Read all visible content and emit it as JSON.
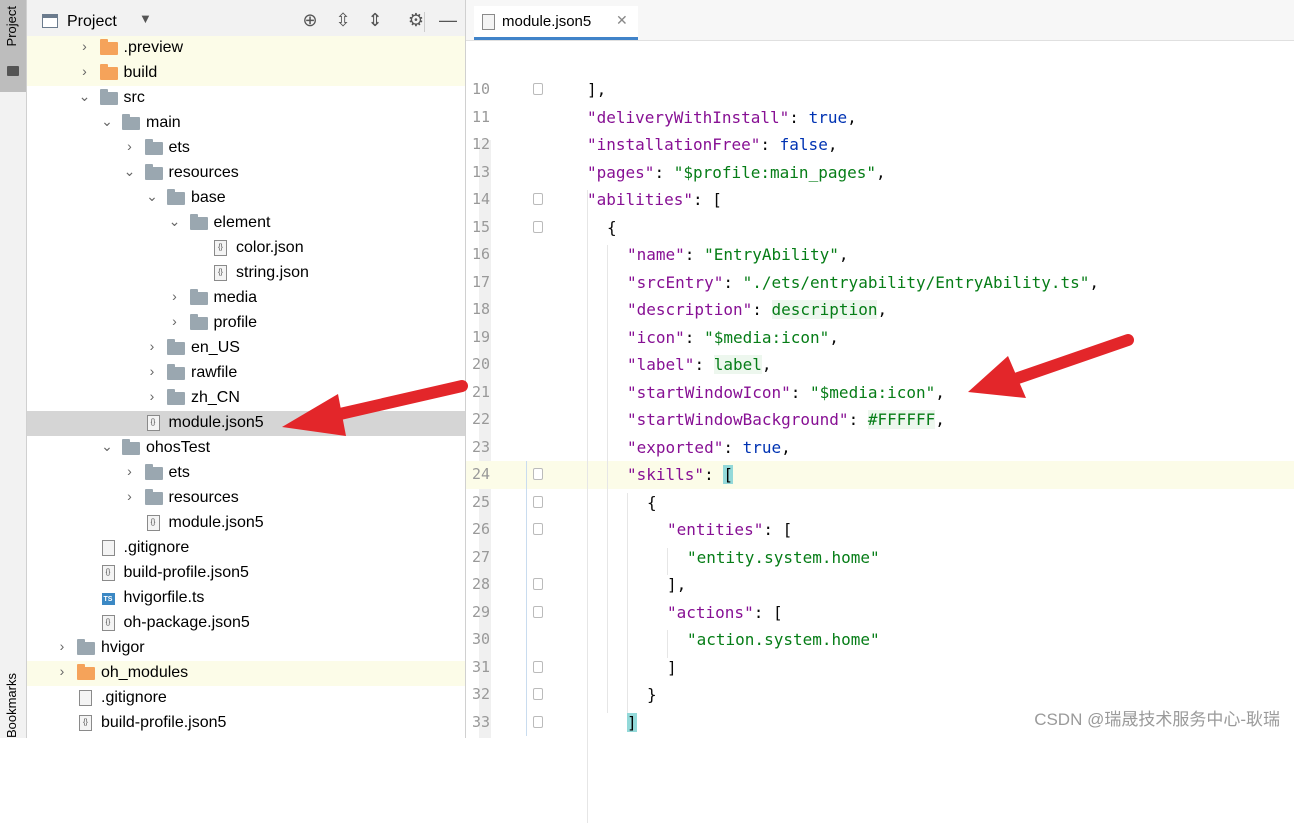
{
  "sidebar_strip": {
    "project_tab": "Project",
    "bookmarks_tab": "Bookmarks"
  },
  "project_panel": {
    "title": "Project",
    "tree": [
      {
        "label": ".preview",
        "type": "folder-orange",
        "indent": 1,
        "expanded": false,
        "highlight": true
      },
      {
        "label": "build",
        "type": "folder-orange",
        "indent": 1,
        "expanded": false,
        "highlight": true
      },
      {
        "label": "src",
        "type": "folder",
        "indent": 1,
        "expanded": true
      },
      {
        "label": "main",
        "type": "folder",
        "indent": 2,
        "expanded": true
      },
      {
        "label": "ets",
        "type": "folder",
        "indent": 3,
        "expanded": false
      },
      {
        "label": "resources",
        "type": "folder",
        "indent": 3,
        "expanded": true
      },
      {
        "label": "base",
        "type": "folder",
        "indent": 4,
        "expanded": true
      },
      {
        "label": "element",
        "type": "folder",
        "indent": 5,
        "expanded": true
      },
      {
        "label": "color.json",
        "type": "json",
        "indent": 6
      },
      {
        "label": "string.json",
        "type": "json",
        "indent": 6
      },
      {
        "label": "media",
        "type": "folder",
        "indent": 5,
        "expanded": false
      },
      {
        "label": "profile",
        "type": "folder",
        "indent": 5,
        "expanded": false
      },
      {
        "label": "en_US",
        "type": "folder",
        "indent": 4,
        "expanded": false
      },
      {
        "label": "rawfile",
        "type": "folder",
        "indent": 4,
        "expanded": false
      },
      {
        "label": "zh_CN",
        "type": "folder",
        "indent": 4,
        "expanded": false
      },
      {
        "label": "module.json5",
        "type": "json",
        "indent": 3,
        "selected": true
      },
      {
        "label": "ohosTest",
        "type": "folder",
        "indent": 2,
        "expanded": true
      },
      {
        "label": "ets",
        "type": "folder",
        "indent": 3,
        "expanded": false
      },
      {
        "label": "resources",
        "type": "folder",
        "indent": 3,
        "expanded": false
      },
      {
        "label": "module.json5",
        "type": "json",
        "indent": 3
      },
      {
        "label": ".gitignore",
        "type": "file",
        "indent": 1
      },
      {
        "label": "build-profile.json5",
        "type": "json",
        "indent": 1
      },
      {
        "label": "hvigorfile.ts",
        "type": "ts",
        "indent": 1
      },
      {
        "label": "oh-package.json5",
        "type": "json",
        "indent": 1
      },
      {
        "label": "hvigor",
        "type": "folder",
        "indent": 0,
        "expanded": false
      },
      {
        "label": "oh_modules",
        "type": "folder-orange",
        "indent": 0,
        "expanded": false,
        "highlight": true
      },
      {
        "label": ".gitignore",
        "type": "file",
        "indent": 0
      },
      {
        "label": "build-profile.json5",
        "type": "json",
        "indent": 0
      }
    ]
  },
  "editor": {
    "tab_label": "module.json5",
    "current_line": 24,
    "lines": [
      {
        "n": "10",
        "indent": 0,
        "parts": [
          [
            "p",
            "],"
          ]
        ]
      },
      {
        "n": "11",
        "indent": 0,
        "parts": [
          [
            "k",
            "\"deliveryWithInstall\""
          ],
          [
            "p",
            ": "
          ],
          [
            "b",
            "true"
          ],
          [
            "p",
            ","
          ]
        ]
      },
      {
        "n": "12",
        "indent": 0,
        "parts": [
          [
            "k",
            "\"installationFree\""
          ],
          [
            "p",
            ": "
          ],
          [
            "b",
            "false"
          ],
          [
            "p",
            ","
          ]
        ]
      },
      {
        "n": "13",
        "indent": 0,
        "parts": [
          [
            "k",
            "\"pages\""
          ],
          [
            "p",
            ": "
          ],
          [
            "s",
            "\"$profile:main_pages\""
          ],
          [
            "p",
            ","
          ]
        ]
      },
      {
        "n": "14",
        "indent": 0,
        "parts": [
          [
            "k",
            "\"abilities\""
          ],
          [
            "p",
            ": ["
          ]
        ]
      },
      {
        "n": "15",
        "indent": 1,
        "parts": [
          [
            "p",
            "{"
          ]
        ]
      },
      {
        "n": "16",
        "indent": 2,
        "parts": [
          [
            "k",
            "\"name\""
          ],
          [
            "p",
            ": "
          ],
          [
            "s",
            "\"EntryAbility\""
          ],
          [
            "p",
            ","
          ]
        ]
      },
      {
        "n": "17",
        "indent": 2,
        "parts": [
          [
            "k",
            "\"srcEntry\""
          ],
          [
            "p",
            ": "
          ],
          [
            "s",
            "\"./ets/entryability/EntryAbility.ts\""
          ],
          [
            "p",
            ","
          ]
        ]
      },
      {
        "n": "18",
        "indent": 2,
        "parts": [
          [
            "k",
            "\"description\""
          ],
          [
            "p",
            ": "
          ],
          [
            "ref",
            "description"
          ],
          [
            "p",
            ","
          ]
        ]
      },
      {
        "n": "19",
        "indent": 2,
        "parts": [
          [
            "k",
            "\"icon\""
          ],
          [
            "p",
            ": "
          ],
          [
            "s",
            "\"$media:icon\""
          ],
          [
            "p",
            ","
          ]
        ]
      },
      {
        "n": "20",
        "indent": 2,
        "parts": [
          [
            "k",
            "\"label\""
          ],
          [
            "p",
            ": "
          ],
          [
            "ref",
            "label"
          ],
          [
            "p",
            ","
          ]
        ]
      },
      {
        "n": "21",
        "indent": 2,
        "parts": [
          [
            "k",
            "\"startWindowIcon\""
          ],
          [
            "p",
            ": "
          ],
          [
            "s",
            "\"$media:icon\""
          ],
          [
            "p",
            ","
          ]
        ]
      },
      {
        "n": "22",
        "indent": 2,
        "parts": [
          [
            "k",
            "\"startWindowBackground\""
          ],
          [
            "p",
            ": "
          ],
          [
            "ref",
            "#FFFFFF"
          ],
          [
            "p",
            ","
          ]
        ]
      },
      {
        "n": "23",
        "indent": 2,
        "parts": [
          [
            "k",
            "\"exported\""
          ],
          [
            "p",
            ": "
          ],
          [
            "b",
            "true"
          ],
          [
            "p",
            ","
          ]
        ]
      },
      {
        "n": "24",
        "indent": 2,
        "parts": [
          [
            "k",
            "\"skills\""
          ],
          [
            "p",
            ": "
          ],
          [
            "bm",
            "["
          ]
        ]
      },
      {
        "n": "25",
        "indent": 3,
        "parts": [
          [
            "p",
            "{"
          ]
        ]
      },
      {
        "n": "26",
        "indent": 4,
        "parts": [
          [
            "k",
            "\"entities\""
          ],
          [
            "p",
            ": ["
          ]
        ]
      },
      {
        "n": "27",
        "indent": 5,
        "parts": [
          [
            "s",
            "\"entity.system.home\""
          ]
        ]
      },
      {
        "n": "28",
        "indent": 4,
        "parts": [
          [
            "p",
            "],"
          ]
        ]
      },
      {
        "n": "29",
        "indent": 4,
        "parts": [
          [
            "k",
            "\"actions\""
          ],
          [
            "p",
            ": ["
          ]
        ]
      },
      {
        "n": "30",
        "indent": 5,
        "parts": [
          [
            "s",
            "\"action.system.home\""
          ]
        ]
      },
      {
        "n": "31",
        "indent": 4,
        "parts": [
          [
            "p",
            "]"
          ]
        ]
      },
      {
        "n": "32",
        "indent": 3,
        "parts": [
          [
            "p",
            "}"
          ]
        ]
      },
      {
        "n": "33",
        "indent": 2,
        "parts": [
          [
            "bm",
            "]"
          ]
        ]
      }
    ]
  },
  "watermark": "CSDN @瑞晟技术服务中心-耿瑞",
  "colors": {
    "annotation_arrow": "#e3262a",
    "selection": "#d5d5d5",
    "highlight": "#fcfce8"
  }
}
